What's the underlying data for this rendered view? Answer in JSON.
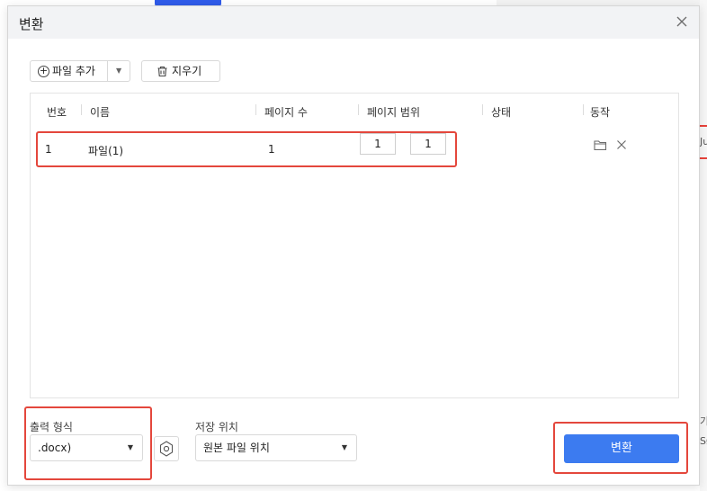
{
  "dialog": {
    "title": "변환"
  },
  "toolbar": {
    "add_file_label": "파일 추가",
    "clear_label": "지우기"
  },
  "table": {
    "columns": [
      "번호",
      "이름",
      "페이지 수",
      "페이지 범위",
      "상태",
      "동작"
    ],
    "rows": [
      {
        "number": "1",
        "name": "파일(1)",
        "pages": "1",
        "range_from": "1",
        "range_to": "1",
        "status": ""
      }
    ]
  },
  "output": {
    "format_label": "출력 형식",
    "format_value": ".docx)",
    "save_location_label": "저장 위치",
    "save_location_value": "원본 파일 위치"
  },
  "actions": {
    "convert_label": "변환"
  },
  "background": {
    "fragment_1": "Ju",
    "fragment_2": "기",
    "fragment_3": "SØ"
  },
  "colors": {
    "accent": "#3c7bf0",
    "highlight": "#e4473c",
    "titlebar_bg": "#f2f3f5"
  }
}
